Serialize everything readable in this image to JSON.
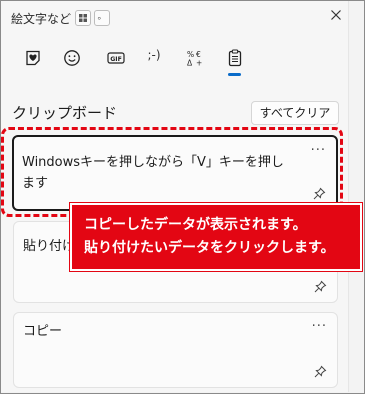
{
  "titlebar": {
    "title": "絵文字など",
    "chip_1_icon": "grid-icon",
    "chip_2_text": "。",
    "close_icon": "close-icon"
  },
  "tabs": [
    {
      "name": "favorites",
      "icon": "heart-sticker-icon"
    },
    {
      "name": "emoji",
      "icon": "smiley-icon"
    },
    {
      "name": "gif",
      "label": "GIF"
    },
    {
      "name": "kaomoji",
      "label": ";-)"
    },
    {
      "name": "symbols",
      "icon": "symbols-icon"
    },
    {
      "name": "clipboard",
      "icon": "clipboard-icon",
      "active": true
    }
  ],
  "clipboard": {
    "title": "クリップボード",
    "clear_all_label": "すべてクリア",
    "items": [
      {
        "text": "Windowsキーを押しながら「V」キーを押します",
        "more": "···"
      },
      {
        "text": "貼り付け",
        "more": "···"
      },
      {
        "text": "コピー",
        "more": "···"
      }
    ]
  },
  "annotation": {
    "line1": "コピーしたデータが表示されます。",
    "line2": "貼り付けたいデータをクリックします。",
    "color": "#e30613"
  },
  "accent_color": "#0a6bc9"
}
